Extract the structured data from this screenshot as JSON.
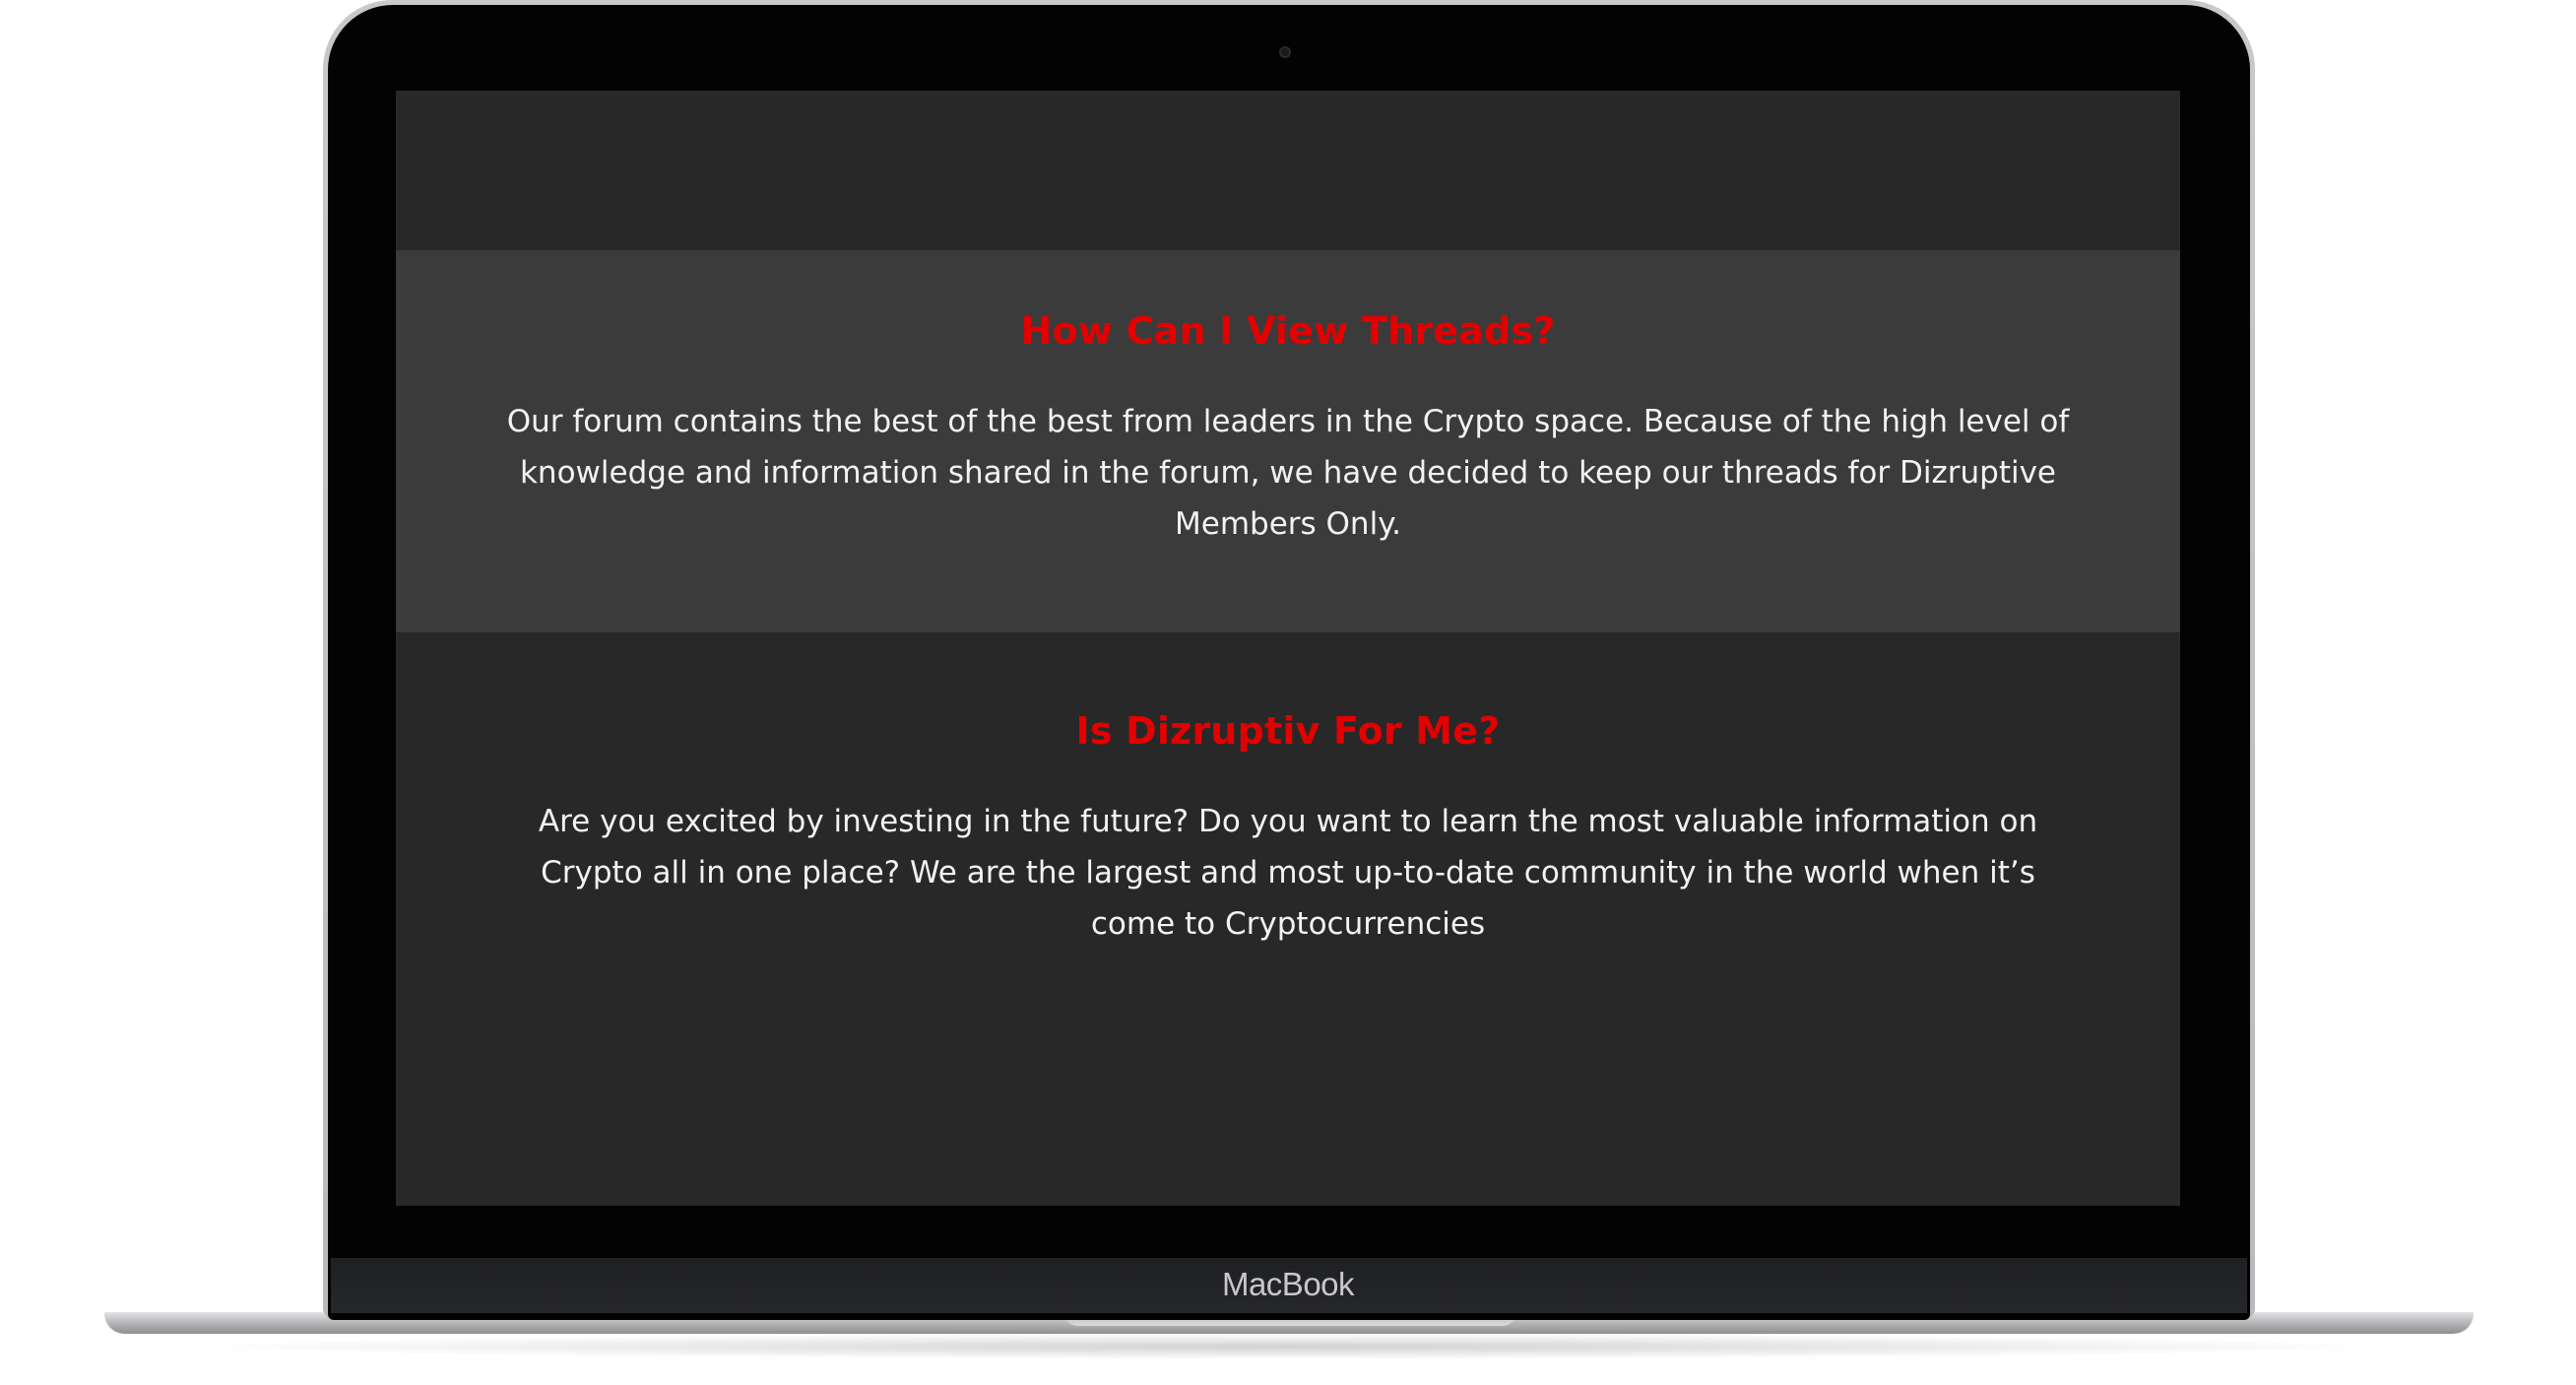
{
  "device": {
    "brand_label": "MacBook"
  },
  "faq": {
    "sections": [
      {
        "heading": "How Can I View Threads?",
        "body": "Our forum contains the best of the best from leaders in the Crypto space. Because of the high level of knowledge and information shared in the forum, we have decided to keep our threads for Dizruptive Members Only."
      },
      {
        "heading": "Is Dizruptiv For Me?",
        "body": "Are you excited by investing in the future? Do you want to learn the most valuable information on Crypto all in one place? We are the largest and most up-to-date community in the world when it’s come to Cryptocurrencies"
      }
    ]
  },
  "colors": {
    "heading": "#e30000",
    "body_text": "#f2f2f2",
    "section_light": "#3b3b3b",
    "section_dark": "#282828"
  }
}
